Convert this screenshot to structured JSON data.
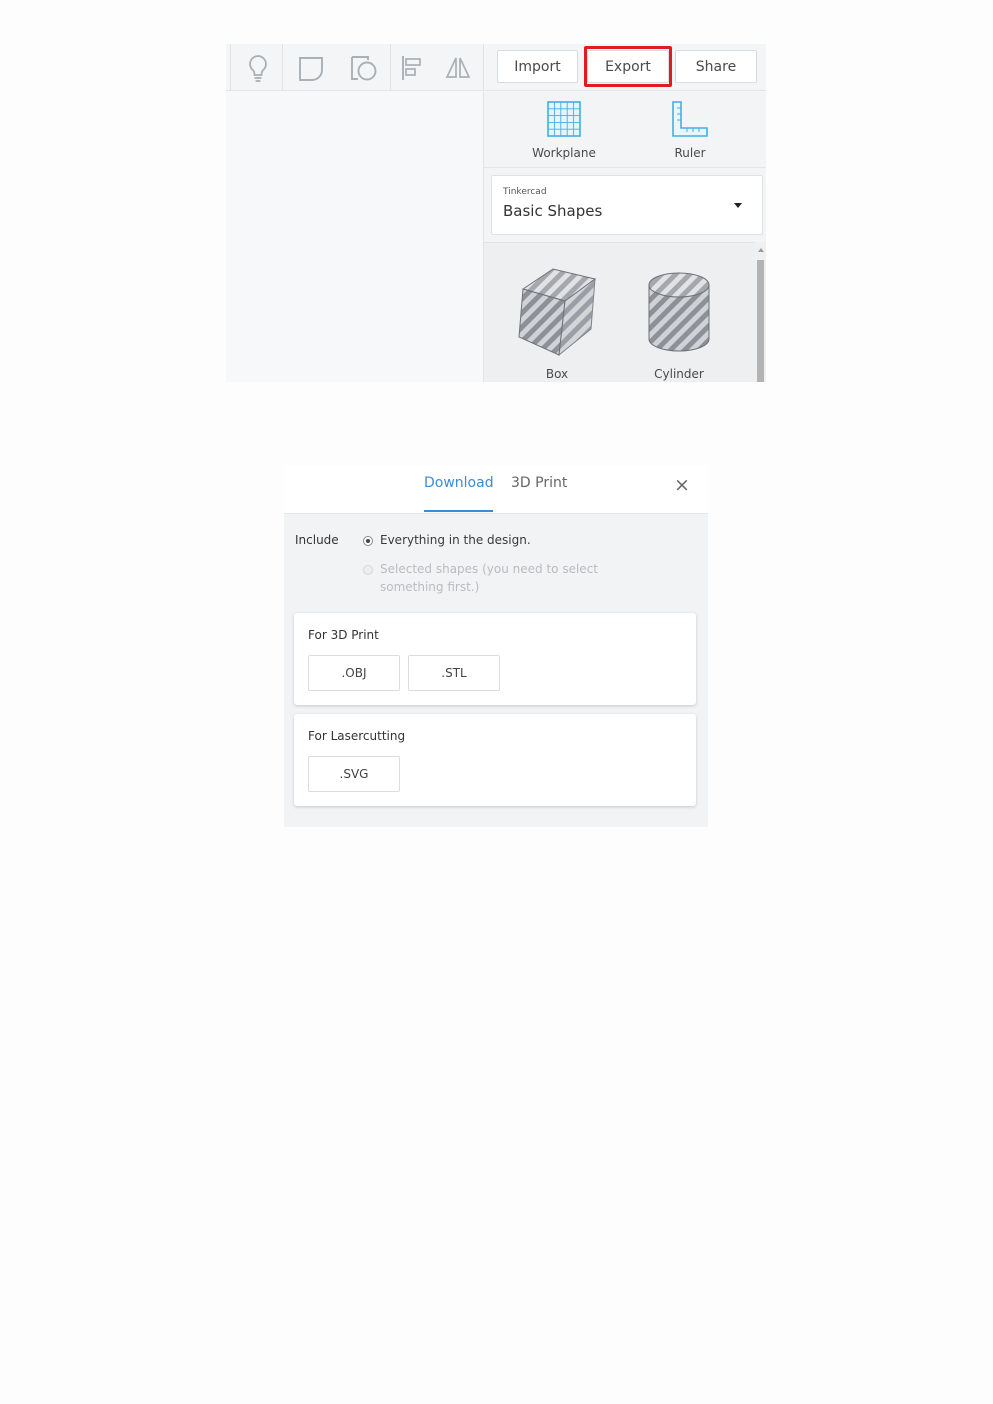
{
  "toolbar": {
    "icons": [
      "lightbulb-icon",
      "group-icon",
      "ungroup-icon",
      "align-icon",
      "mirror-icon"
    ],
    "import_label": "Import",
    "export_label": "Export",
    "share_label": "Share",
    "highlight_color": "#e01b24"
  },
  "panel": {
    "workplane_label": "Workplane",
    "ruler_label": "Ruler",
    "library_small": "Tinkercad",
    "library_big": "Basic Shapes",
    "shapes": [
      {
        "label": "Box",
        "icon": "box-shape-icon"
      },
      {
        "label": "Cylinder",
        "icon": "cylinder-shape-icon"
      }
    ],
    "accent_color": "#3fb1e5"
  },
  "dialog": {
    "tabs": [
      {
        "label": "Download",
        "active": true
      },
      {
        "label": "3D Print",
        "active": false
      }
    ],
    "close_label": "×",
    "include_label": "Include",
    "option_everything": "Everything in the design.",
    "option_selected_line1": "Selected shapes (you need to select",
    "option_selected_line2": "something first.)",
    "section_3dprint": {
      "title": "For 3D Print",
      "buttons": [
        ".OBJ",
        ".STL"
      ]
    },
    "section_laser": {
      "title": "For Lasercutting",
      "buttons": [
        ".SVG"
      ]
    },
    "accent_color": "#3a8dd6"
  }
}
